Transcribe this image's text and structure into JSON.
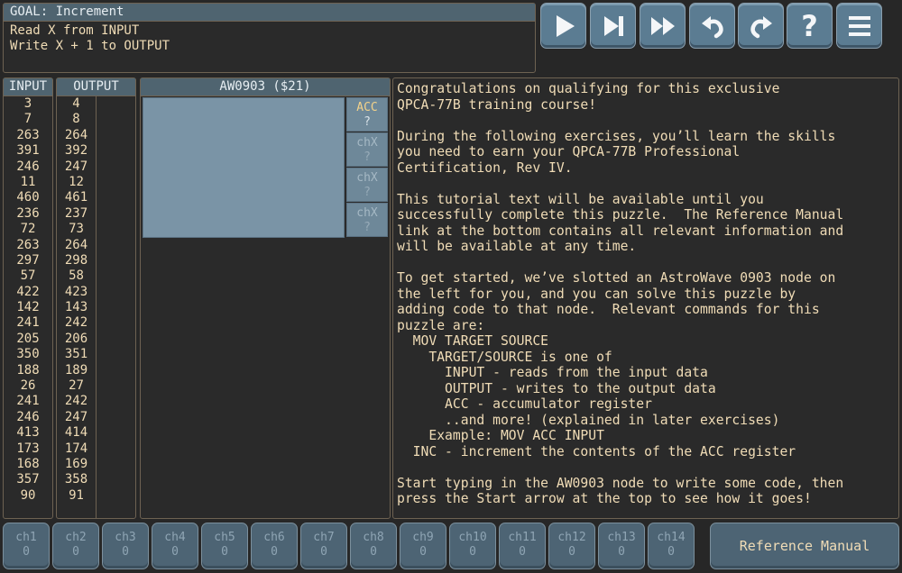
{
  "goal": {
    "title": "GOAL: Increment",
    "lines": [
      "Read X from INPUT",
      "Write X + 1 to OUTPUT"
    ]
  },
  "toolbar": [
    {
      "name": "play-button",
      "icon": "play-icon"
    },
    {
      "name": "step-button",
      "icon": "step-icon"
    },
    {
      "name": "fast-forward-button",
      "icon": "fast-forward-icon"
    },
    {
      "name": "undo-button",
      "icon": "undo-icon"
    },
    {
      "name": "redo-button",
      "icon": "redo-icon"
    },
    {
      "name": "help-button",
      "icon": "question-icon",
      "label": "?"
    },
    {
      "name": "menu-button",
      "icon": "menu-icon"
    }
  ],
  "input": {
    "header": "INPUT",
    "values": [
      "3",
      "7",
      "263",
      "391",
      "246",
      "11",
      "460",
      "236",
      "72",
      "263",
      "297",
      "57",
      "422",
      "142",
      "241",
      "205",
      "350",
      "188",
      "26",
      "241",
      "246",
      "413",
      "173",
      "168",
      "357",
      "90"
    ]
  },
  "output": {
    "header": "OUTPUT",
    "values": [
      "4",
      "8",
      "264",
      "392",
      "247",
      "12",
      "461",
      "237",
      "73",
      "264",
      "298",
      "58",
      "423",
      "143",
      "242",
      "206",
      "351",
      "189",
      "27",
      "242",
      "247",
      "414",
      "174",
      "169",
      "358",
      "91"
    ]
  },
  "node": {
    "title": "AW0903 ($21)",
    "code": "",
    "registers": [
      {
        "name": "ACC",
        "value": "?"
      },
      {
        "name": "chX",
        "value": "?"
      },
      {
        "name": "chX",
        "value": "?"
      },
      {
        "name": "chX",
        "value": "?"
      }
    ]
  },
  "tutorial": {
    "text": "Congratulations on qualifying for this exclusive\nQPCA-77B training course!\n\nDuring the following exercises, you’ll learn the skills\nyou need to earn your QPCA-77B Professional\nCertification, Rev IV.\n\nThis tutorial text will be available until you\nsuccessfully complete this puzzle.  The Reference Manual\nlink at the bottom contains all relevant information and\nwill be available at any time.\n\nTo get started, we’ve slotted an AstroWave 0903 node on\nthe left for you, and you can solve this puzzle by\nadding code to that node.  Relevant commands for this\npuzzle are:\n  MOV TARGET SOURCE\n    TARGET/SOURCE is one of\n      INPUT - reads from the input data\n      OUTPUT - writes to the output data\n      ACC - accumulator register\n      ..and more! (explained in later exercises)\n    Example: MOV ACC INPUT\n  INC - increment the contents of the ACC register\n\nStart typing in the AW0903 node to write some code, then\npress the Start arrow at the top to see how it goes!"
  },
  "channels": [
    {
      "name": "ch1",
      "value": "0"
    },
    {
      "name": "ch2",
      "value": "0"
    },
    {
      "name": "ch3",
      "value": "0"
    },
    {
      "name": "ch4",
      "value": "0"
    },
    {
      "name": "ch5",
      "value": "0"
    },
    {
      "name": "ch6",
      "value": "0"
    },
    {
      "name": "ch7",
      "value": "0"
    },
    {
      "name": "ch8",
      "value": "0"
    },
    {
      "name": "ch9",
      "value": "0"
    },
    {
      "name": "ch10",
      "value": "0"
    },
    {
      "name": "ch11",
      "value": "0"
    },
    {
      "name": "ch12",
      "value": "0"
    },
    {
      "name": "ch13",
      "value": "0"
    },
    {
      "name": "ch14",
      "value": "0"
    }
  ],
  "reference_manual": {
    "label": "Reference Manual"
  },
  "colors": {
    "background": "#272727",
    "header": "#4f6470",
    "button": "#5b7c92",
    "text": "#f0dcb6",
    "accent": "#f3d28a"
  }
}
